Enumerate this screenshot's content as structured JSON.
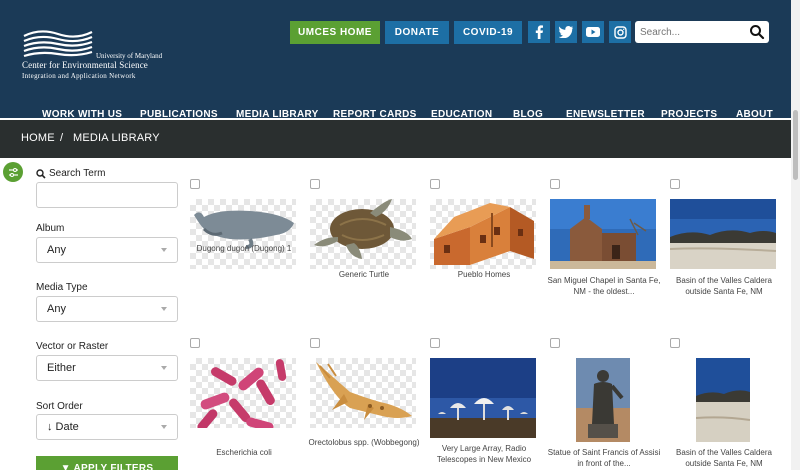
{
  "brand": {
    "line1": "University of Maryland",
    "line2": "Center for Environmental Science",
    "line3": "Integration and Application Network"
  },
  "topbar": {
    "umces_label": "UMCES HOME",
    "donate_label": "DONATE",
    "covid_label": "COVID-19",
    "search_placeholder": "Search..."
  },
  "social": {
    "facebook": "f",
    "twitter": "t",
    "youtube": "▶",
    "instagram": "◎"
  },
  "nav": [
    "WORK WITH US",
    "PUBLICATIONS",
    "MEDIA LIBRARY",
    "REPORT CARDS",
    "EDUCATION",
    "BLOG",
    "ENEWSLETTER",
    "PROJECTS",
    "ABOUT"
  ],
  "breadcrumb": {
    "home": "HOME",
    "separator": "/",
    "current": "MEDIA LIBRARY"
  },
  "sidebar": {
    "search_label": "Search Term",
    "search_value": "",
    "album_label": "Album",
    "album_value": "Any",
    "media_type_label": "Media Type",
    "media_type_value": "Any",
    "vector_label": "Vector or Raster",
    "vector_value": "Either",
    "sort_label": "Sort Order",
    "sort_value": "↓ Date",
    "apply_label": "▼ APPLY FILTERS"
  },
  "media": [
    {
      "caption": "Dugong dugon (Dugong) 1"
    },
    {
      "caption": "Generic Turtle"
    },
    {
      "caption": "Pueblo Homes"
    },
    {
      "caption": "San Miguel Chapel in Santa Fe, NM - the oldest..."
    },
    {
      "caption": "Basin of the Valles Caldera outside Santa Fe, NM"
    },
    {
      "caption": "Escherichia coli"
    },
    {
      "caption": "Orectolobus spp. (Wobbegong)"
    },
    {
      "caption": "Very Large Array, Radio Telescopes in New Mexico"
    },
    {
      "caption": "Statue of Saint Francis of Assisi in front of the..."
    },
    {
      "caption": "Basin of the Valles Caldera outside Santa Fe, NM"
    }
  ],
  "colors": {
    "header_bg": "#1b3a57",
    "breadcrumb_bg": "#2a2f2f",
    "green": "#5ba033",
    "blue": "#1d6fa5"
  }
}
